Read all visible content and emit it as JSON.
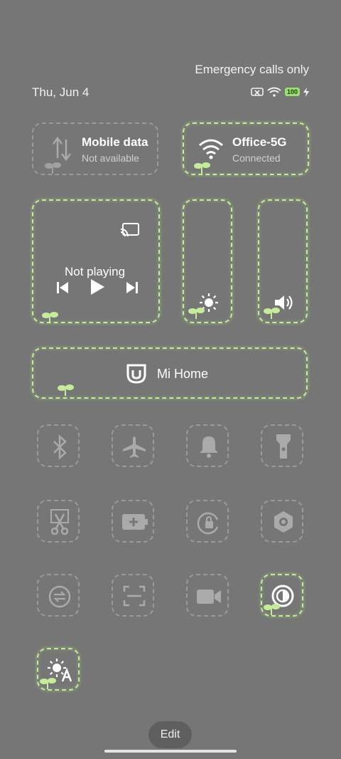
{
  "status": {
    "emergency": "Emergency calls only",
    "date": "Thu, Jun 4",
    "battery": "100"
  },
  "tiles": {
    "mobile": {
      "title": "Mobile data",
      "subtitle": "Not available",
      "icon": "mobile-data-icon",
      "active": false
    },
    "wifi": {
      "title": "Office-5G",
      "subtitle": "Connected",
      "icon": "wifi-icon",
      "active": true
    },
    "media": {
      "title": "Not playing",
      "icon": "cast-icon"
    },
    "brightness": {
      "icon": "sun-icon"
    },
    "volume": {
      "icon": "speaker-icon"
    },
    "mihome": {
      "label": "Mi Home",
      "icon": "mi-home-icon"
    }
  },
  "toggles": [
    {
      "name": "bluetooth",
      "icon": "bluetooth-icon",
      "active": false
    },
    {
      "name": "airplane",
      "icon": "airplane-icon",
      "active": false
    },
    {
      "name": "sound",
      "icon": "bell-icon",
      "active": false
    },
    {
      "name": "flashlight",
      "icon": "flashlight-icon",
      "active": false
    },
    {
      "name": "screenshot",
      "icon": "scissors-icon",
      "active": false
    },
    {
      "name": "battery-saver",
      "icon": "battery-plus-icon",
      "active": false
    },
    {
      "name": "lock-rotation",
      "icon": "rotation-lock-icon",
      "active": false
    },
    {
      "name": "settings",
      "icon": "hex-nut-icon",
      "active": false
    },
    {
      "name": "data-saver",
      "icon": "data-saver-icon",
      "active": false
    },
    {
      "name": "scanner",
      "icon": "scan-icon",
      "active": false
    },
    {
      "name": "screen-recorder",
      "icon": "video-camera-icon",
      "active": false
    },
    {
      "name": "dark-mode",
      "icon": "contrast-icon",
      "active": true
    },
    {
      "name": "auto-brightness",
      "icon": "auto-brightness-icon",
      "active": true
    }
  ],
  "colors": {
    "background": "#767676",
    "accent_green": "#c6ec9b",
    "inactive": "#9a9a9a"
  },
  "edit_label": "Edit"
}
